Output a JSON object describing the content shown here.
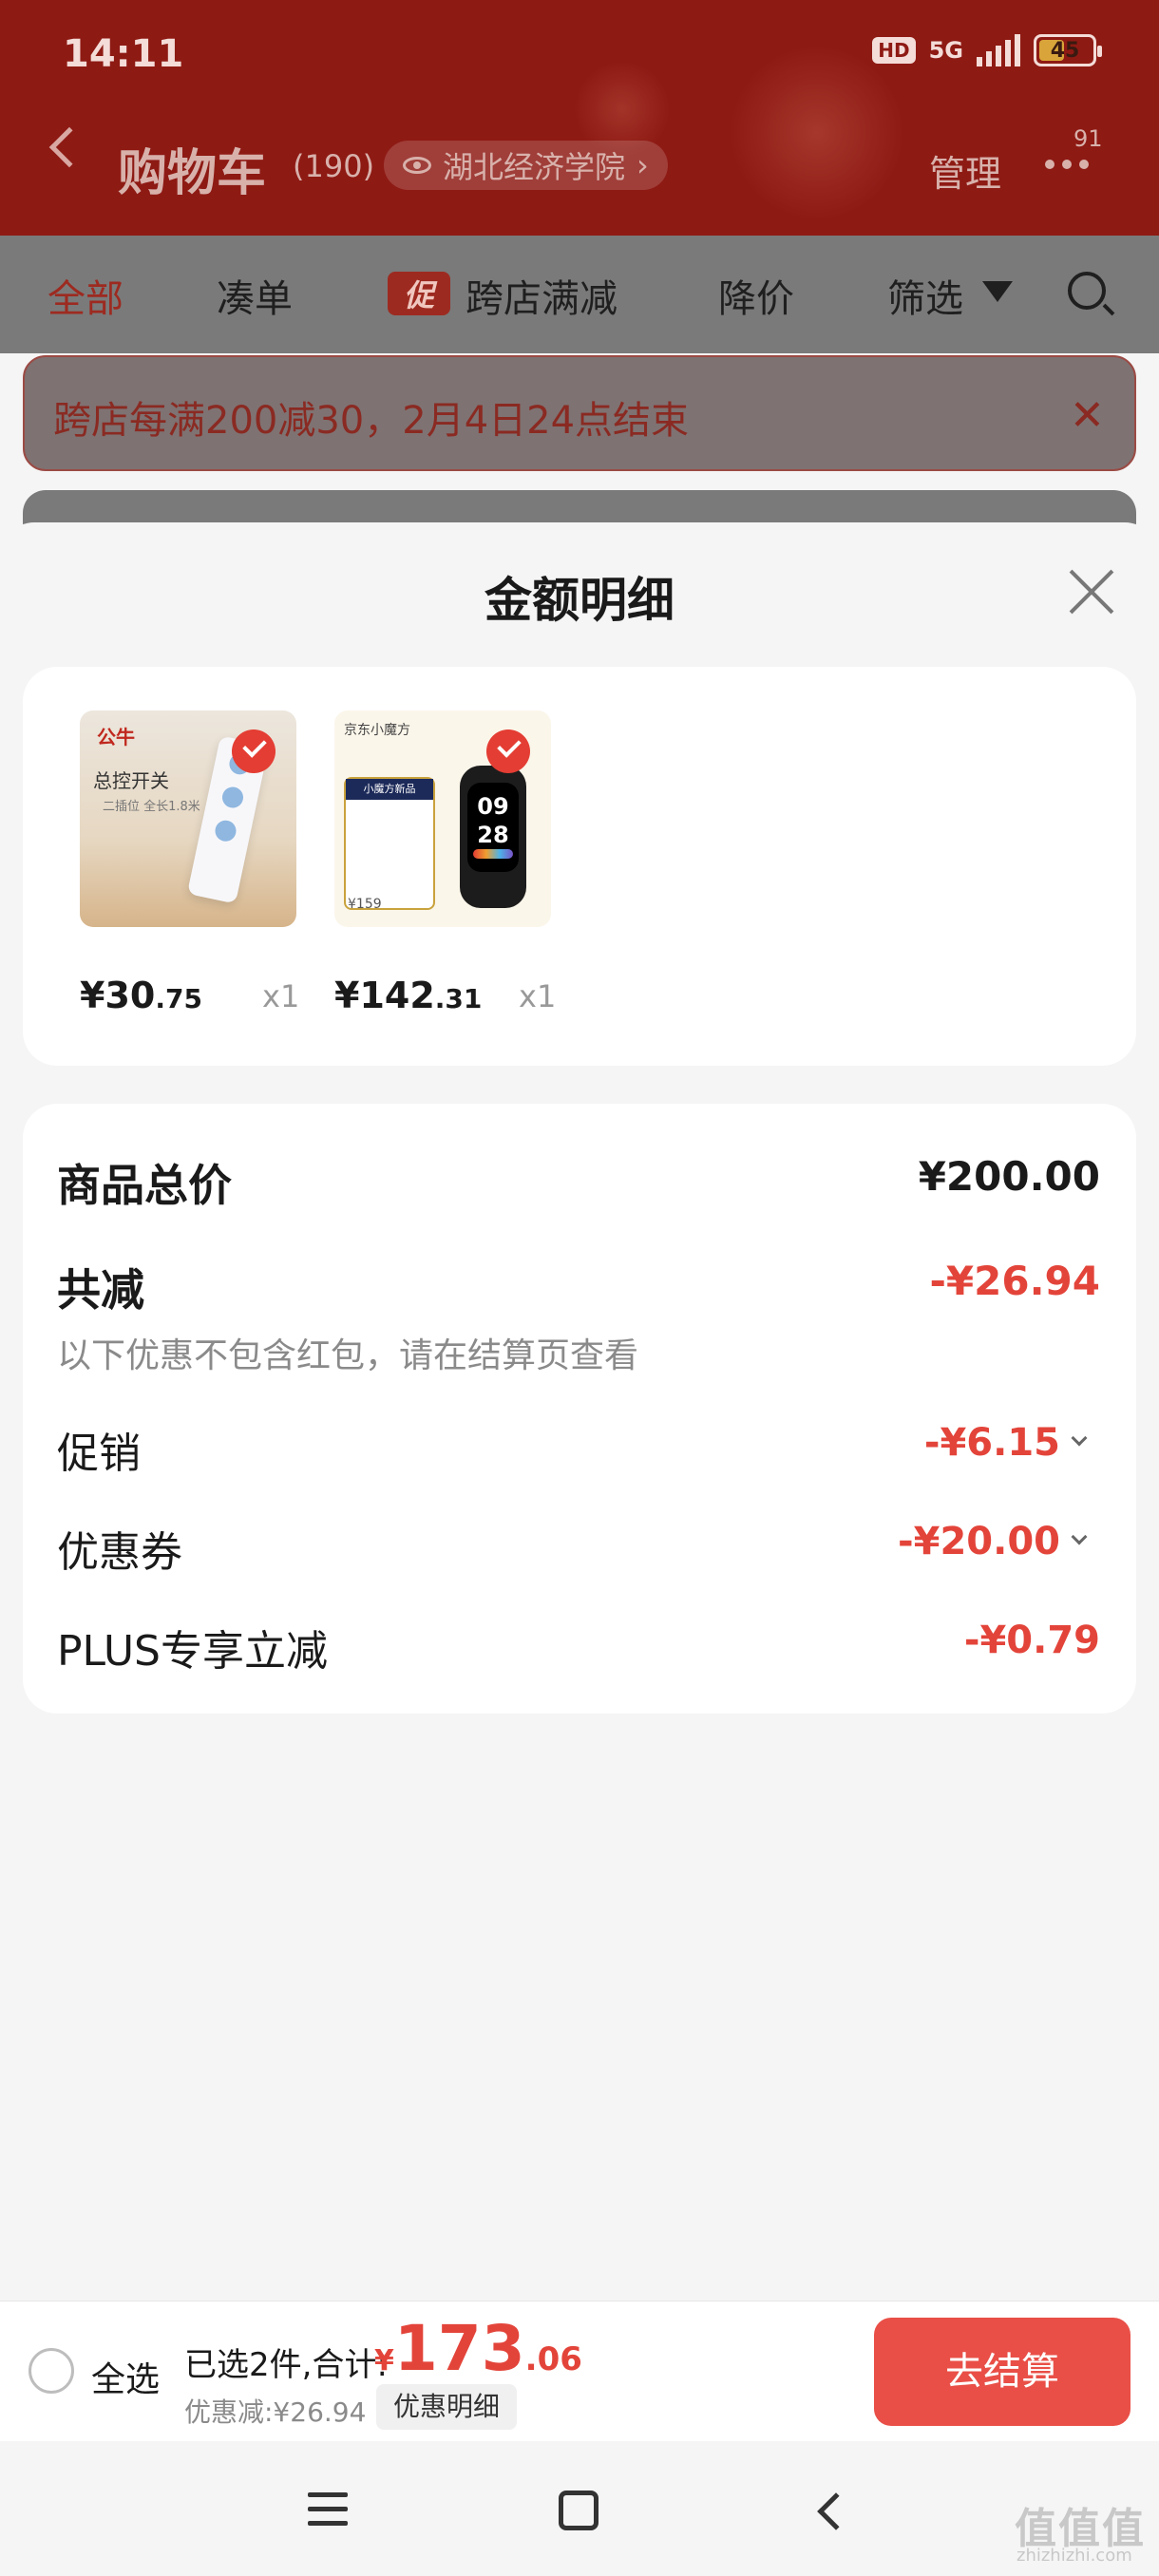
{
  "status_bar": {
    "time": "14:11",
    "hd": "HD",
    "network": "5G",
    "battery": "45"
  },
  "header": {
    "title": "购物车",
    "count": "(190)",
    "location": "湖北经济学院",
    "manage": "管理",
    "message_badge": "91"
  },
  "tabs": {
    "all": "全部",
    "bundle": "凑单",
    "promo_badge": "促",
    "cross_store": "跨店满减",
    "price_drop": "降价",
    "filter": "筛选"
  },
  "notice": {
    "text": "跨店每满200减30，2月4日24点结束",
    "close": "✕"
  },
  "sheet": {
    "title": "金额明细",
    "products": [
      {
        "name": "公牛总控开关插座",
        "price_int": "¥30",
        "price_dec": ".75",
        "qty": "x1",
        "brand": "公牛",
        "headline": "总控开关",
        "sub": "二插位 全长1.8米"
      },
      {
        "name": "Redmi 手环3 黑色",
        "price_int": "¥142",
        "price_dec": ".31",
        "qty": "x1",
        "header": "京东小魔方",
        "badge": "小魔方新品",
        "watch_time_h": "09",
        "watch_time_m": "28",
        "tag_price": "¥159"
      }
    ],
    "summary": {
      "total_label": "商品总价",
      "total_value": "¥200.00",
      "discount_label": "共减",
      "discount_value": "-¥26.94",
      "note": "以下优惠不包含红包，请在结算页查看",
      "promo_label": "促销",
      "promo_value": "-¥6.15",
      "coupon_label": "优惠券",
      "coupon_value": "-¥20.00",
      "plus_label": "PLUS专享立减",
      "plus_value": "-¥0.79"
    }
  },
  "bottom_bar": {
    "select_all": "全选",
    "selected_text": "已选2件,合计:",
    "currency": "¥",
    "total_int": "173",
    "total_dec": ".06",
    "discount_text": "优惠减:¥26.94",
    "detail_button": "优惠明细",
    "checkout": "去结算"
  },
  "watermark": {
    "main": "值值值",
    "sub": "zhizhizhi.com"
  },
  "colors": {
    "header_bg": "#8e1a14",
    "accent_red": "#e3443a",
    "checkout_bg": "#e94f47"
  }
}
